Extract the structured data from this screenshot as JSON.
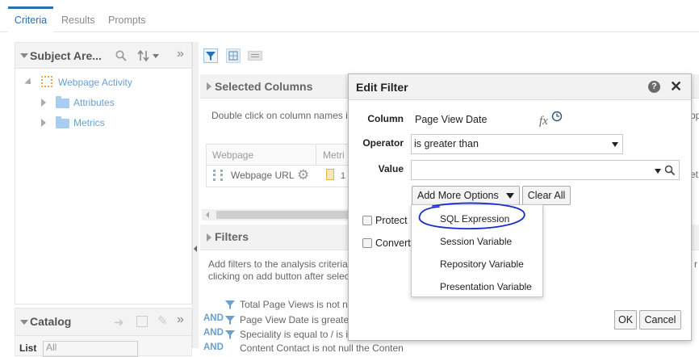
{
  "tabs": [
    "Criteria",
    "Results",
    "Prompts"
  ],
  "subject_area": {
    "title": "Subject Are...",
    "root": "Webpage Activity",
    "folders": [
      "Attributes",
      "Metrics"
    ]
  },
  "catalog": {
    "title": "Catalog",
    "list_label": "List",
    "list_value": "All"
  },
  "selected_columns": {
    "title": "Selected Columns",
    "hint": "Double click on column names i",
    "hint_tail": "pp",
    "col1_header": "Webpage",
    "col2_header": "Metri",
    "col1_value": "Webpage URL",
    "col2_value": "1",
    "col_tail": "et"
  },
  "filters": {
    "title": "Filters",
    "hint_line1": "Add filters to the analysis criteria",
    "hint_line2": "clicking on add button after selec",
    "right_tail": "r",
    "and_label": "AND",
    "items": [
      "Total Page Views is not n",
      "Page View Date  is greate",
      "Speciality is equal to / is i",
      "Content Contact  is not null  the Conten"
    ]
  },
  "edit_filter": {
    "title": "Edit Filter",
    "column_label": "Column",
    "column_value": "Page View Date",
    "fx_label": "fx",
    "operator_label": "Operator",
    "operator_value": "is greater than",
    "value_label": "Value",
    "value_value": "",
    "add_more_label": "Add More Options",
    "clear_all_label": "Clear All",
    "protect_label": "Protect F",
    "convert_label": "Convert",
    "ok_label": "OK",
    "cancel_label": "Cancel"
  },
  "menu": {
    "items": [
      "SQL Expression",
      "Session Variable",
      "Repository Variable",
      "Presentation Variable"
    ]
  },
  "colors": {
    "accent": "#2a6fb0",
    "annotation": "#1a2ccf",
    "folder": "#a9cdee"
  }
}
